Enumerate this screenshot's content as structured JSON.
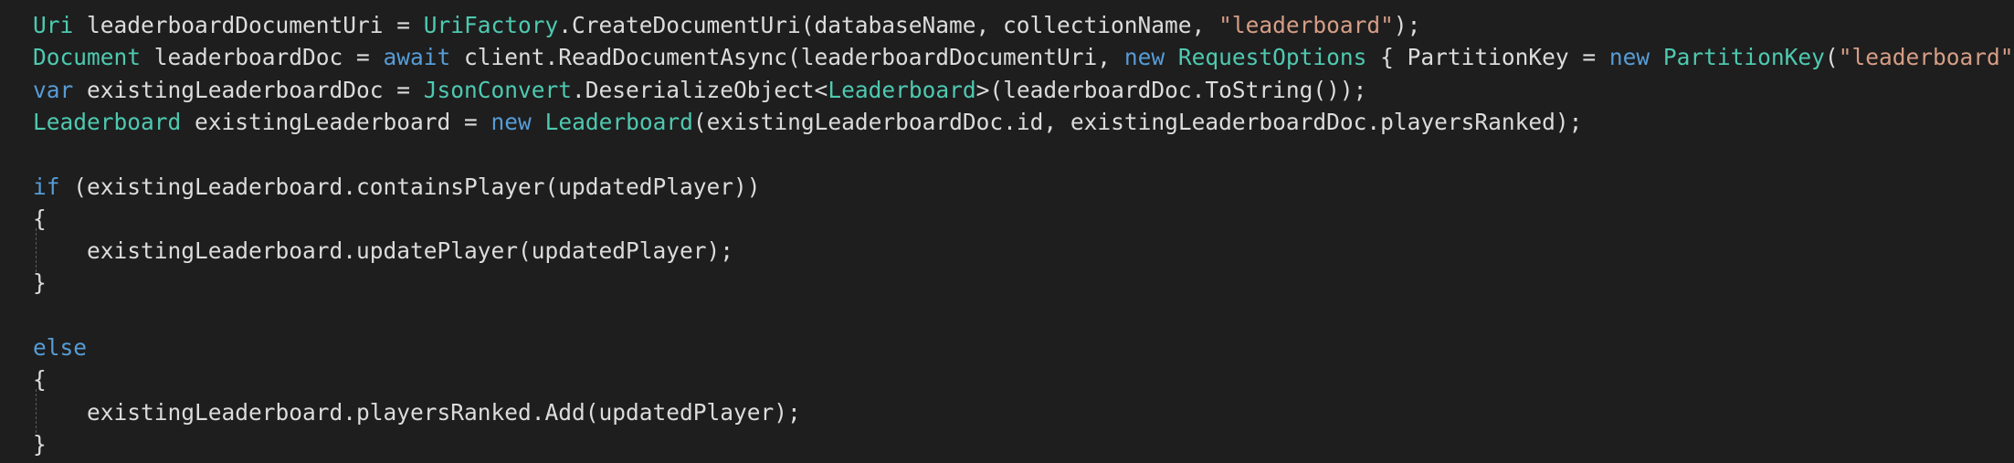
{
  "colors": {
    "background": "#1e1e1e",
    "plain": "#dcdcdc",
    "keyword": "#569cd6",
    "type": "#4ec9b0",
    "string": "#d69d85"
  },
  "code": {
    "lines": [
      [
        {
          "t": "Uri",
          "k": "ty"
        },
        {
          "t": " leaderboardDocumentUri = ",
          "k": "pl"
        },
        {
          "t": "UriFactory",
          "k": "ty"
        },
        {
          "t": ".CreateDocumentUri(databaseName, collectionName, ",
          "k": "pl"
        },
        {
          "t": "\"leaderboard\"",
          "k": "str"
        },
        {
          "t": ");",
          "k": "pl"
        }
      ],
      [
        {
          "t": "Document",
          "k": "ty"
        },
        {
          "t": " leaderboardDoc = ",
          "k": "pl"
        },
        {
          "t": "await",
          "k": "kw"
        },
        {
          "t": " client.ReadDocumentAsync(leaderboardDocumentUri, ",
          "k": "pl"
        },
        {
          "t": "new",
          "k": "kw"
        },
        {
          "t": " ",
          "k": "pl"
        },
        {
          "t": "RequestOptions",
          "k": "ty"
        },
        {
          "t": " { PartitionKey = ",
          "k": "pl"
        },
        {
          "t": "new",
          "k": "kw"
        },
        {
          "t": " ",
          "k": "pl"
        },
        {
          "t": "PartitionKey",
          "k": "ty"
        },
        {
          "t": "(",
          "k": "pl"
        },
        {
          "t": "\"leaderboard\"",
          "k": "str"
        }
      ],
      [
        {
          "t": "var",
          "k": "kw"
        },
        {
          "t": " existingLeaderboardDoc = ",
          "k": "pl"
        },
        {
          "t": "JsonConvert",
          "k": "ty"
        },
        {
          "t": ".DeserializeObject<",
          "k": "pl"
        },
        {
          "t": "Leaderboard",
          "k": "ty"
        },
        {
          "t": ">(leaderboardDoc.ToString());",
          "k": "pl"
        }
      ],
      [
        {
          "t": "Leaderboard",
          "k": "ty"
        },
        {
          "t": " existingLeaderboard = ",
          "k": "pl"
        },
        {
          "t": "new",
          "k": "kw"
        },
        {
          "t": " ",
          "k": "pl"
        },
        {
          "t": "Leaderboard",
          "k": "ty"
        },
        {
          "t": "(existingLeaderboardDoc.id, existingLeaderboardDoc.playersRanked);",
          "k": "pl"
        }
      ],
      [],
      [
        {
          "t": "if",
          "k": "kw"
        },
        {
          "t": " (existingLeaderboard.containsPlayer(updatedPlayer))",
          "k": "pl"
        }
      ],
      [
        {
          "t": "{",
          "k": "pl"
        }
      ],
      [
        {
          "t": "    existingLeaderboard.updatePlayer(updatedPlayer);",
          "k": "pl"
        }
      ],
      [
        {
          "t": "}",
          "k": "pl"
        }
      ],
      [],
      [
        {
          "t": "else",
          "k": "kw"
        }
      ],
      [
        {
          "t": "{",
          "k": "pl"
        }
      ],
      [
        {
          "t": "    existingLeaderboard.playersRanked.Add(updatedPlayer);",
          "k": "pl"
        }
      ],
      [
        {
          "t": "}",
          "k": "pl"
        }
      ]
    ]
  }
}
